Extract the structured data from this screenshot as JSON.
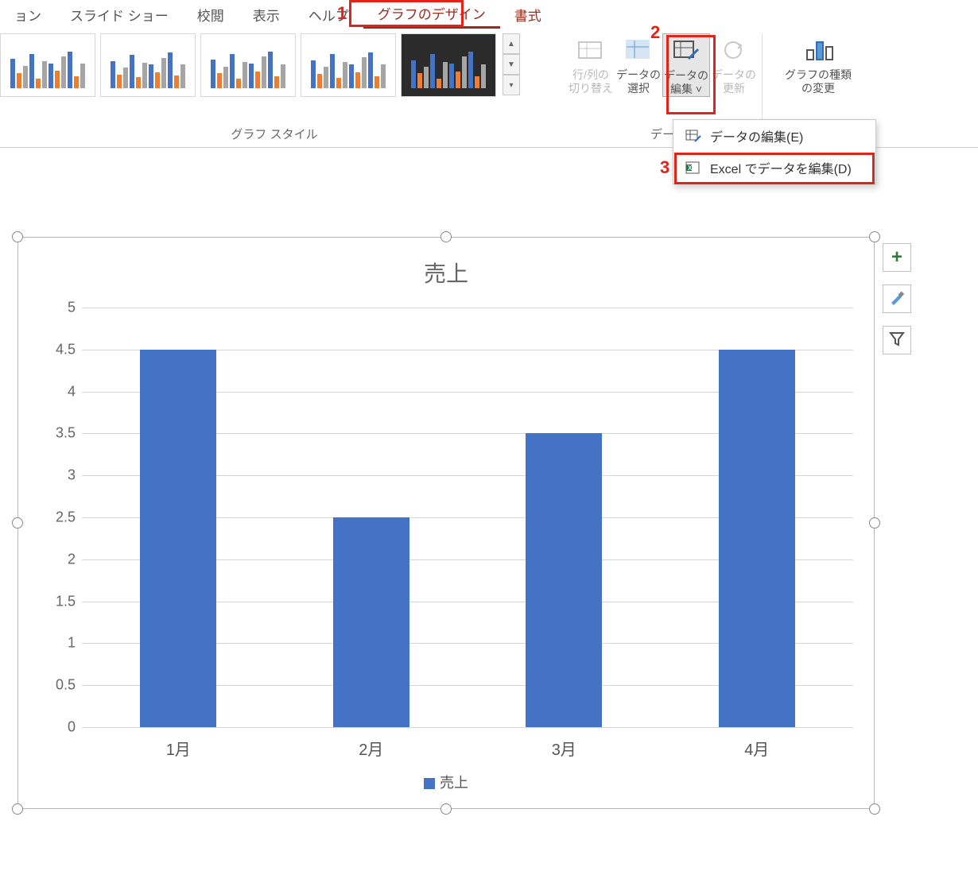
{
  "tabs": {
    "presentation": "ョン",
    "slideshow": "スライド ショー",
    "review": "校閲",
    "view": "表示",
    "help": "ヘルプ",
    "chart_design": "グラフのデザイン",
    "format": "書式"
  },
  "ribbon": {
    "styles_label": "グラフ スタイル",
    "data_label_partial": "デー",
    "cmd_switch_rowcol_l1": "行/列の",
    "cmd_switch_rowcol_l2": "切り替え",
    "cmd_select_data_l1": "データの",
    "cmd_select_data_l2": "選択",
    "cmd_edit_data_l1": "データの",
    "cmd_edit_data_l2": "編集",
    "cmd_refresh_data_l1": "データの",
    "cmd_refresh_data_l2": "更新",
    "cmd_change_type_l1": "グラフの種類",
    "cmd_change_type_l2": "の変更"
  },
  "dropdown": {
    "edit_data": "データの編集(E)",
    "edit_in_excel": "Excel でデータを編集(D)"
  },
  "callouts": {
    "one": "1",
    "two": "2",
    "three": "3"
  },
  "chart_data": {
    "type": "bar",
    "title": "売上",
    "categories": [
      "1月",
      "2月",
      "3月",
      "4月"
    ],
    "values": [
      4.5,
      2.5,
      3.5,
      4.5
    ],
    "yticks": [
      "0",
      "0.5",
      "1",
      "1.5",
      "2",
      "2.5",
      "3",
      "3.5",
      "4",
      "4.5",
      "5"
    ],
    "ylim": [
      0,
      5
    ],
    "legend": "売上",
    "series_color": "#4472C4"
  }
}
